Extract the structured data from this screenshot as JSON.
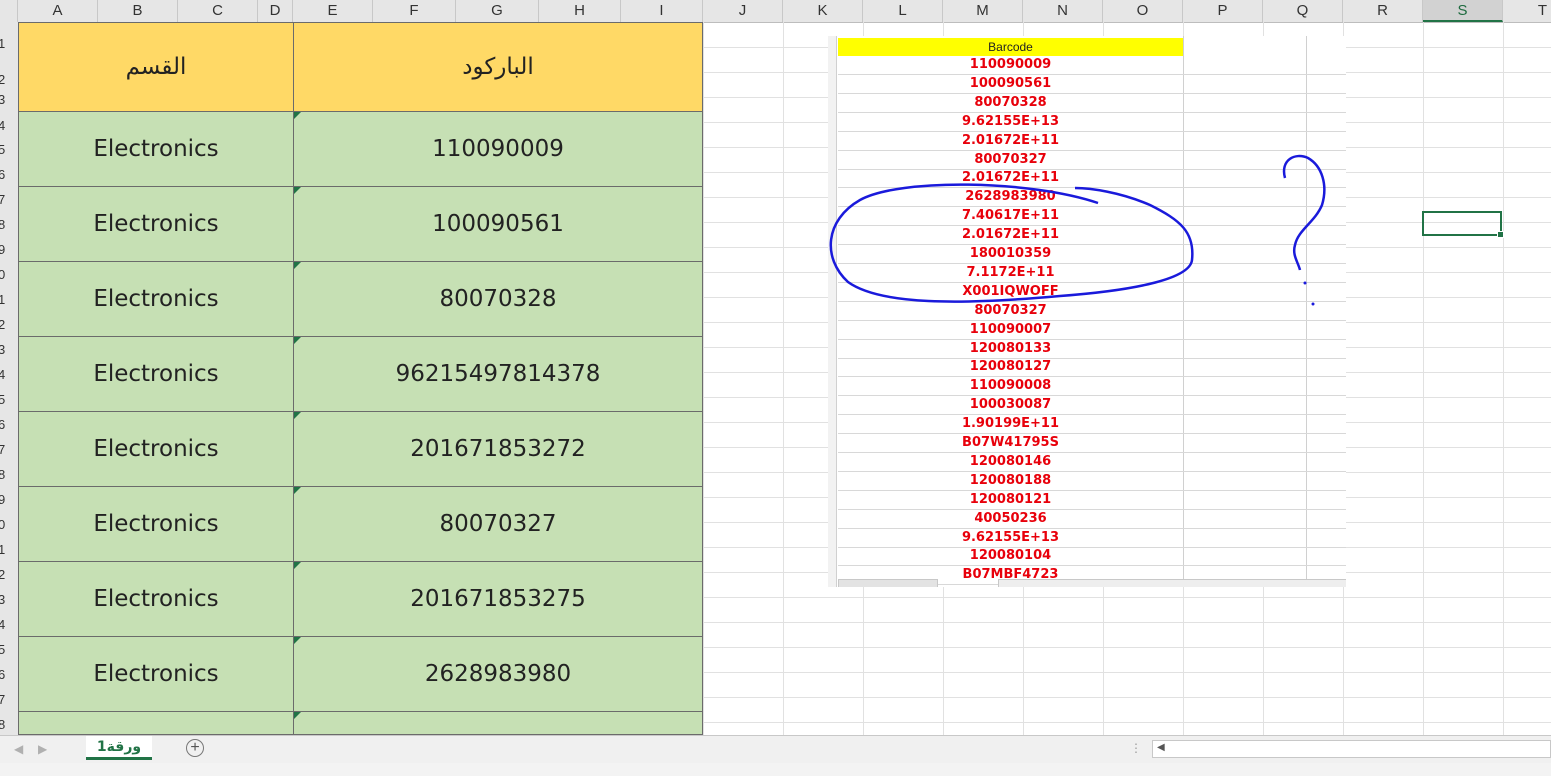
{
  "columns": [
    "A",
    "B",
    "C",
    "D",
    "E",
    "F",
    "G",
    "H",
    "I",
    "J",
    "K",
    "L",
    "M",
    "N",
    "O",
    "P",
    "Q",
    "R",
    "S",
    "T"
  ],
  "selected_column": "S",
  "rows": [
    "1",
    "2",
    "3",
    "4",
    "5",
    "6",
    "7",
    "8",
    "9",
    "0",
    "1",
    "2",
    "3",
    "4",
    "5",
    "6",
    "7",
    "8",
    "9",
    "0",
    "1",
    "2",
    "3",
    "4",
    "5",
    "6",
    "7",
    "8"
  ],
  "table": {
    "header_dept": "القسم",
    "header_barcode": "الباركود",
    "rows": [
      {
        "dept": "Electronics",
        "barcode": "110090009"
      },
      {
        "dept": "Electronics",
        "barcode": "100090561"
      },
      {
        "dept": "Electronics",
        "barcode": "80070328"
      },
      {
        "dept": "Electronics",
        "barcode": "96215497814378"
      },
      {
        "dept": "Electronics",
        "barcode": "201671853272"
      },
      {
        "dept": "Electronics",
        "barcode": "80070327"
      },
      {
        "dept": "Electronics",
        "barcode": "201671853275"
      },
      {
        "dept": "Electronics",
        "barcode": "2628983980"
      }
    ]
  },
  "picture": {
    "header": "Barcode",
    "values": [
      "110090009",
      "100090561",
      "80070328",
      "9.62155E+13",
      "2.01672E+11",
      "80070327",
      "2.01672E+11",
      "2628983980",
      "7.40617E+11",
      "2.01672E+11",
      "180010359",
      "7.1172E+11",
      "X001IQWOFF",
      "80070327",
      "110090007",
      "120080133",
      "120080127",
      "110090008",
      "100030087",
      "1.90199E+11",
      "B07W41795S",
      "120080146",
      "120080188",
      "120080121",
      "40050236",
      "9.62155E+13",
      "120080104",
      "B07MBF4723"
    ]
  },
  "sheet_tab": "ورقة1",
  "colors": {
    "header_fill": "#ffd966",
    "body_fill": "#c6e0b4",
    "accent": "#217346",
    "annotation": "#1a1adb",
    "picture_text": "#e8000b"
  }
}
